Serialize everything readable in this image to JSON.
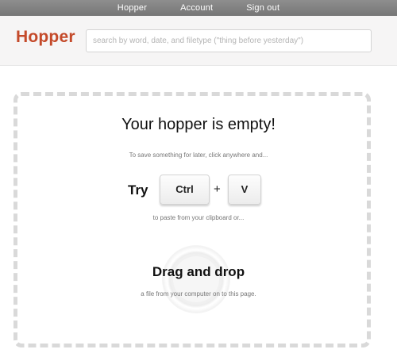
{
  "nav": {
    "links": [
      "Hopper",
      "Account",
      "Sign out"
    ]
  },
  "header": {
    "logo": "Hopper",
    "search_placeholder": "search by word, date, and filetype (\"thing before yesterday\")"
  },
  "main": {
    "title": "Your hopper is empty!",
    "hint_save": "To save something for later, click anywhere and...",
    "try_label": "Try",
    "key_ctrl": "Ctrl",
    "plus": "+",
    "key_v": "V",
    "hint_paste": "to paste from your clipboard or...",
    "drag_title": "Drag and drop",
    "drag_hint": "a file from your computer on to this page."
  },
  "colors": {
    "brand": "#c44a2a",
    "nav_bg": "#808080",
    "header_bg": "#f6f5f5",
    "dashed_border": "#d9d9d9"
  }
}
